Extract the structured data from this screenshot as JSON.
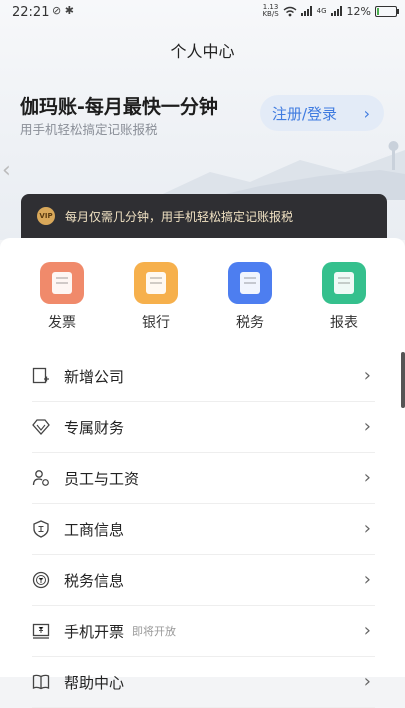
{
  "status_bar": {
    "time": "22:21",
    "left_icons": "⊘ ✱",
    "net_speed_value": "1.13",
    "net_speed_unit": "KB/S",
    "signal_label": "4G",
    "battery": "12%",
    "battery_level": 0.12
  },
  "header": {
    "title": "个人中心"
  },
  "hero": {
    "headline": "伽玛账-每月最快一分钟",
    "subline": "用手机轻松搞定记账报税",
    "login_label": "注册/登录",
    "login_arrow": "›",
    "side_arrow": "‹"
  },
  "promo": {
    "badge": "VIP",
    "text": "每月仅需几分钟，用手机轻松搞定记账报税"
  },
  "quick_actions": [
    {
      "label": "发票",
      "icon": "invoice-icon",
      "color": "#f08a6b"
    },
    {
      "label": "银行",
      "icon": "bank-icon",
      "color": "#f6b04c"
    },
    {
      "label": "税务",
      "icon": "tax-icon",
      "color": "#4d7ef0"
    },
    {
      "label": "报表",
      "icon": "report-icon",
      "color": "#35c08d"
    }
  ],
  "menu": [
    {
      "label": "新增公司",
      "icon": "add-company-icon",
      "tag": ""
    },
    {
      "label": "专属财务",
      "icon": "diamond-icon",
      "tag": ""
    },
    {
      "label": "员工与工资",
      "icon": "employee-icon",
      "tag": ""
    },
    {
      "label": "工商信息",
      "icon": "shield-icon",
      "tag": ""
    },
    {
      "label": "税务信息",
      "icon": "tax-info-icon",
      "tag": ""
    },
    {
      "label": "手机开票",
      "icon": "mobile-invoice-icon",
      "tag": "即将开放"
    },
    {
      "label": "帮助中心",
      "icon": "book-icon",
      "tag": ""
    }
  ],
  "chevron": "›",
  "colors": {
    "accent": "#3f7be0",
    "promo_bg": "#2f2f33",
    "promo_text": "#f1e2c3"
  }
}
